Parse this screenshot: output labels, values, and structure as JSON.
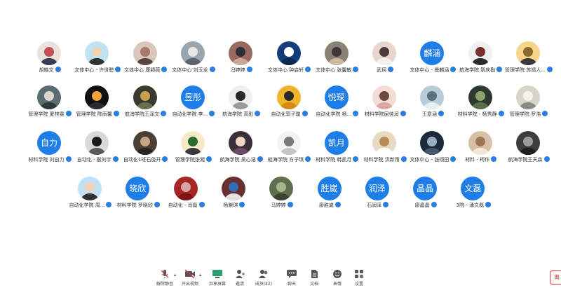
{
  "participants_row1": [
    {
      "name": "胡皓文",
      "avatar": "photo-anime"
    },
    {
      "name": "文体中心 - 许世聪",
      "avatar": "photo-glasses"
    },
    {
      "name": "文体中心 康颖薇",
      "avatar": "photo-child"
    },
    {
      "name": "文体中心 刘玉龙",
      "avatar": "photo-keepcalm"
    },
    {
      "name": "冯婷婷",
      "avatar": "photo-rabbit"
    },
    {
      "name": "文体中心 钟启轩",
      "avatar": "photo-keepcalm-blue"
    },
    {
      "name": "文体中心 张馨敏",
      "avatar": "photo-street"
    },
    {
      "name": "武珂",
      "avatar": "photo-mask"
    },
    {
      "name": "文体中心 - 曼麟涵",
      "text": "麟涵"
    },
    {
      "name": "航海学院 靳庆勤",
      "avatar": "photo-cartoon"
    },
    {
      "name": "管理学院 苏靖人...",
      "avatar": "photo-bear"
    }
  ],
  "participants_row2": [
    {
      "name": "管理学院 夏梓雯",
      "avatar": "photo-cat"
    },
    {
      "name": "管理学院 陈雨馨",
      "avatar": "photo-dark"
    },
    {
      "name": "航海学院王泽文",
      "avatar": "photo-ornament"
    },
    {
      "name": "自动化学院 李...",
      "text": "昱彤"
    },
    {
      "name": "航海学院 高彤",
      "avatar": "photo-sketch"
    },
    {
      "name": "自动化郭子璇",
      "avatar": "photo-poster"
    },
    {
      "name": "自动化学院 杨...",
      "text": "悦琛"
    },
    {
      "name": "材料学院屈佳润",
      "avatar": "photo-girl"
    },
    {
      "name": "王意涵",
      "avatar": "photo-lake"
    },
    {
      "name": "材料学院 - 杨秀静",
      "avatar": "photo-plant"
    },
    {
      "name": "管理学院 罗浩",
      "avatar": "photo-sheep"
    }
  ],
  "participants_row3": [
    {
      "name": "材料学院 刘自力",
      "text": "自力"
    },
    {
      "name": "自动化 - 殷刘宇",
      "avatar": "photo-person-dark"
    },
    {
      "name": "自动化1班石俊开",
      "avatar": "photo-portrait"
    },
    {
      "name": "管理学院张湘",
      "avatar": "photo-cartoon-kid"
    },
    {
      "name": "航海学院 吴心涵",
      "avatar": "photo-anime-girl"
    },
    {
      "name": "航海学院 方子琪",
      "avatar": "photo-sketch-girl"
    },
    {
      "name": "材料学院 韩凯月",
      "text": "凯月"
    },
    {
      "name": "材料学院 洪新雨",
      "avatar": "photo-dog"
    },
    {
      "name": "文体中心 - 张栩田",
      "avatar": "photo-night"
    },
    {
      "name": "材料 - 柯作",
      "avatar": "photo-room"
    },
    {
      "name": "航海学院王天森",
      "avatar": "photo-silhouette"
    }
  ],
  "participants_row4": [
    {
      "name": "自动化学院 周...",
      "avatar": "photo-glasses"
    },
    {
      "name": "材料学院 罗晓欣",
      "text": "晓欣"
    },
    {
      "name": "自动化 - 肖磊",
      "avatar": "photo-red"
    },
    {
      "name": "杨紫琪",
      "avatar": "photo-stage"
    },
    {
      "name": "马婷婷",
      "avatar": "photo-tree"
    },
    {
      "name": "廖胜崴",
      "text": "胜崴"
    },
    {
      "name": "石润泽",
      "text": "润泽"
    },
    {
      "name": "廖晶晶",
      "text": "晶晶"
    },
    {
      "name": "3院 - 潘文磊",
      "text": "文磊"
    }
  ],
  "toolbar": {
    "items": [
      {
        "label": "解除静音",
        "icon": "mic-muted-icon"
      },
      {
        "label": "开启视频",
        "icon": "video-off-icon"
      },
      {
        "label": "共享屏幕",
        "icon": "share-screen-icon"
      },
      {
        "label": "邀请",
        "icon": "invite-icon"
      },
      {
        "label": "成员(42)",
        "icon": "members-icon"
      },
      {
        "label": "聊天",
        "icon": "chat-icon"
      },
      {
        "label": "文档",
        "icon": "document-icon"
      },
      {
        "label": "表情",
        "icon": "emoji-icon"
      },
      {
        "label": "设置",
        "icon": "settings-icon"
      }
    ],
    "corner_label": "离"
  },
  "colors": {
    "text_avatar_bg": "#1e7de6",
    "mic_badge": "#2a7de1"
  }
}
